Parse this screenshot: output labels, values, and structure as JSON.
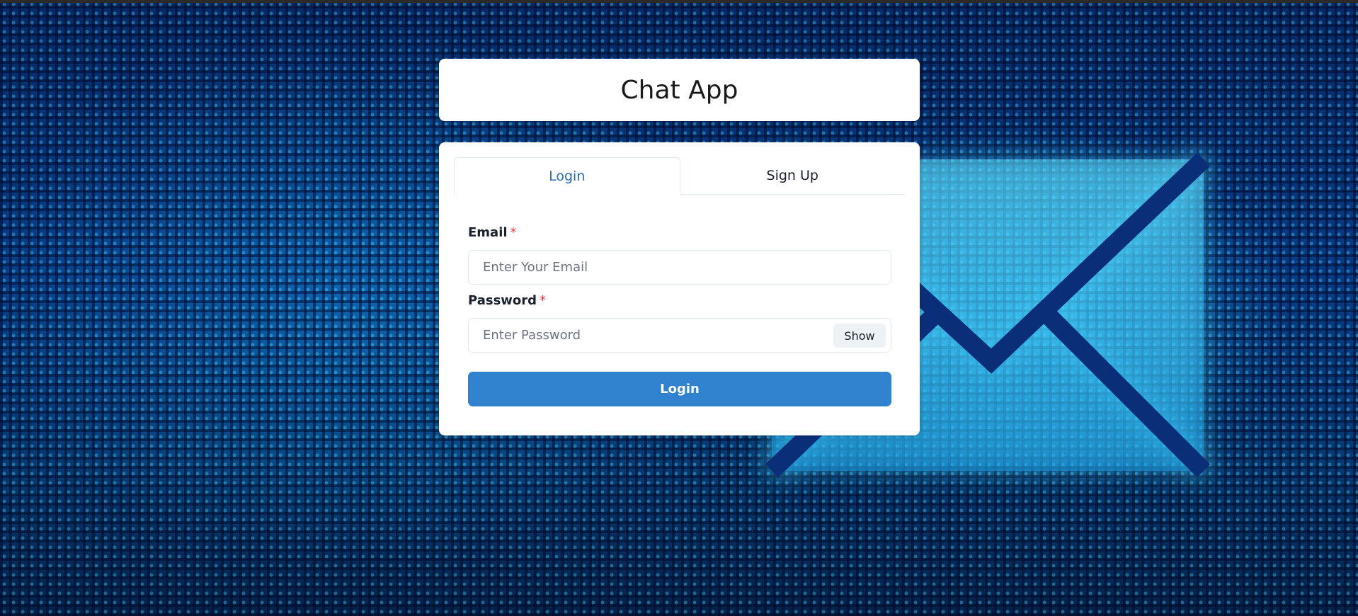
{
  "app": {
    "title": "Chat App"
  },
  "tabs": [
    {
      "label": "Login",
      "active": true
    },
    {
      "label": "Sign Up",
      "active": false
    }
  ],
  "form": {
    "email_label": "Email",
    "email_placeholder": "Enter Your Email",
    "email_value": "",
    "password_label": "Password",
    "password_placeholder": "Enter Password",
    "password_value": "",
    "required_marker": "*",
    "show_label": "Show",
    "submit_label": "Login"
  },
  "colors": {
    "accent": "#3182ce",
    "active_tab_text": "#2b6cb0",
    "required": "#e53e3e",
    "background": "#073b86"
  },
  "icons": {
    "background_graphic": "envelope-icon"
  }
}
